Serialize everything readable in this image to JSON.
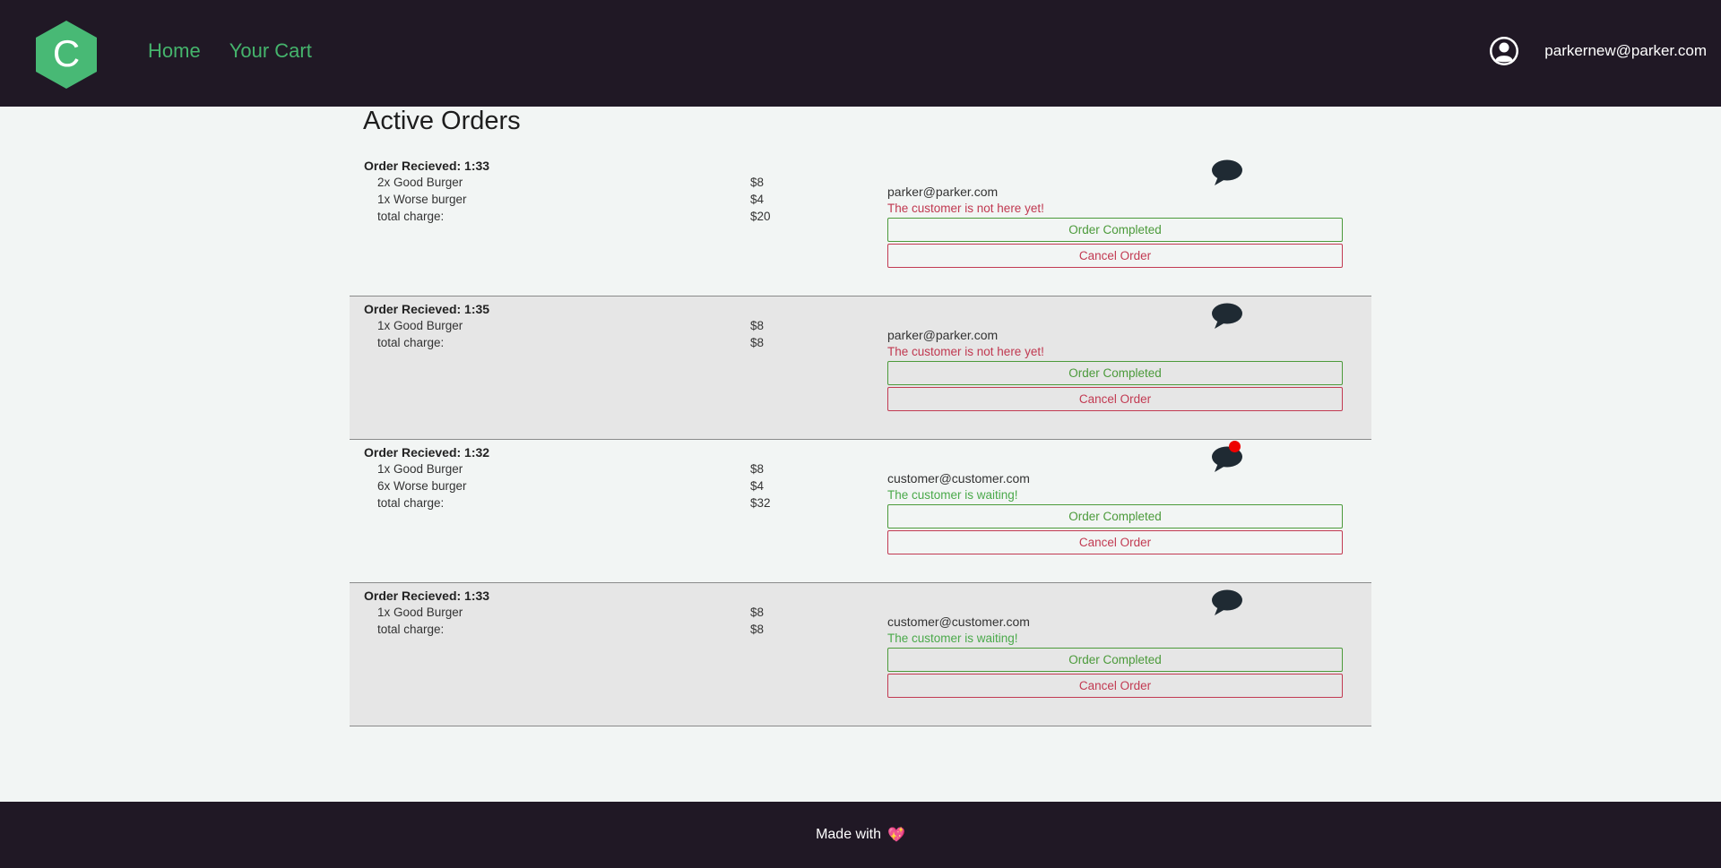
{
  "nav": {
    "home": "Home",
    "cart": "Your Cart"
  },
  "header": {
    "logo_letter": "C",
    "user_email": "parkernew@parker.com"
  },
  "page": {
    "title": "Active Orders"
  },
  "buttons": {
    "complete": "Order Completed",
    "cancel": "Cancel Order"
  },
  "orders": [
    {
      "received": "Order Recieved: 1:33",
      "items": [
        {
          "name": "2x Good Burger",
          "price": "$8"
        },
        {
          "name": "1x Worse burger",
          "price": "$4"
        },
        {
          "name": "total charge:",
          "price": "$20"
        }
      ],
      "customer": "parker@parker.com",
      "status": "The customer is not here yet!",
      "has_notification": false
    },
    {
      "received": "Order Recieved: 1:35",
      "items": [
        {
          "name": "1x Good Burger",
          "price": "$8"
        },
        {
          "name": "total charge:",
          "price": "$8"
        }
      ],
      "customer": "parker@parker.com",
      "status": "The customer is not here yet!",
      "has_notification": false
    },
    {
      "received": "Order Recieved: 1:32",
      "items": [
        {
          "name": "1x Good Burger",
          "price": "$8"
        },
        {
          "name": "6x Worse burger",
          "price": "$4"
        },
        {
          "name": "total charge:",
          "price": "$32"
        }
      ],
      "customer": "customer@customer.com",
      "status": "The customer is waiting!",
      "has_notification": true
    },
    {
      "received": "Order Recieved: 1:33",
      "items": [
        {
          "name": "1x Good Burger",
          "price": "$8"
        },
        {
          "name": "total charge:",
          "price": "$8"
        }
      ],
      "customer": "customer@customer.com",
      "status": "The customer is waiting!",
      "has_notification": false
    }
  ],
  "footer": {
    "text": "Made with",
    "heart": "💖"
  },
  "colors": {
    "header_bg": "#201825",
    "accent_green": "#45b46c",
    "status_red": "#c03850",
    "status_green": "#4aa94a"
  }
}
